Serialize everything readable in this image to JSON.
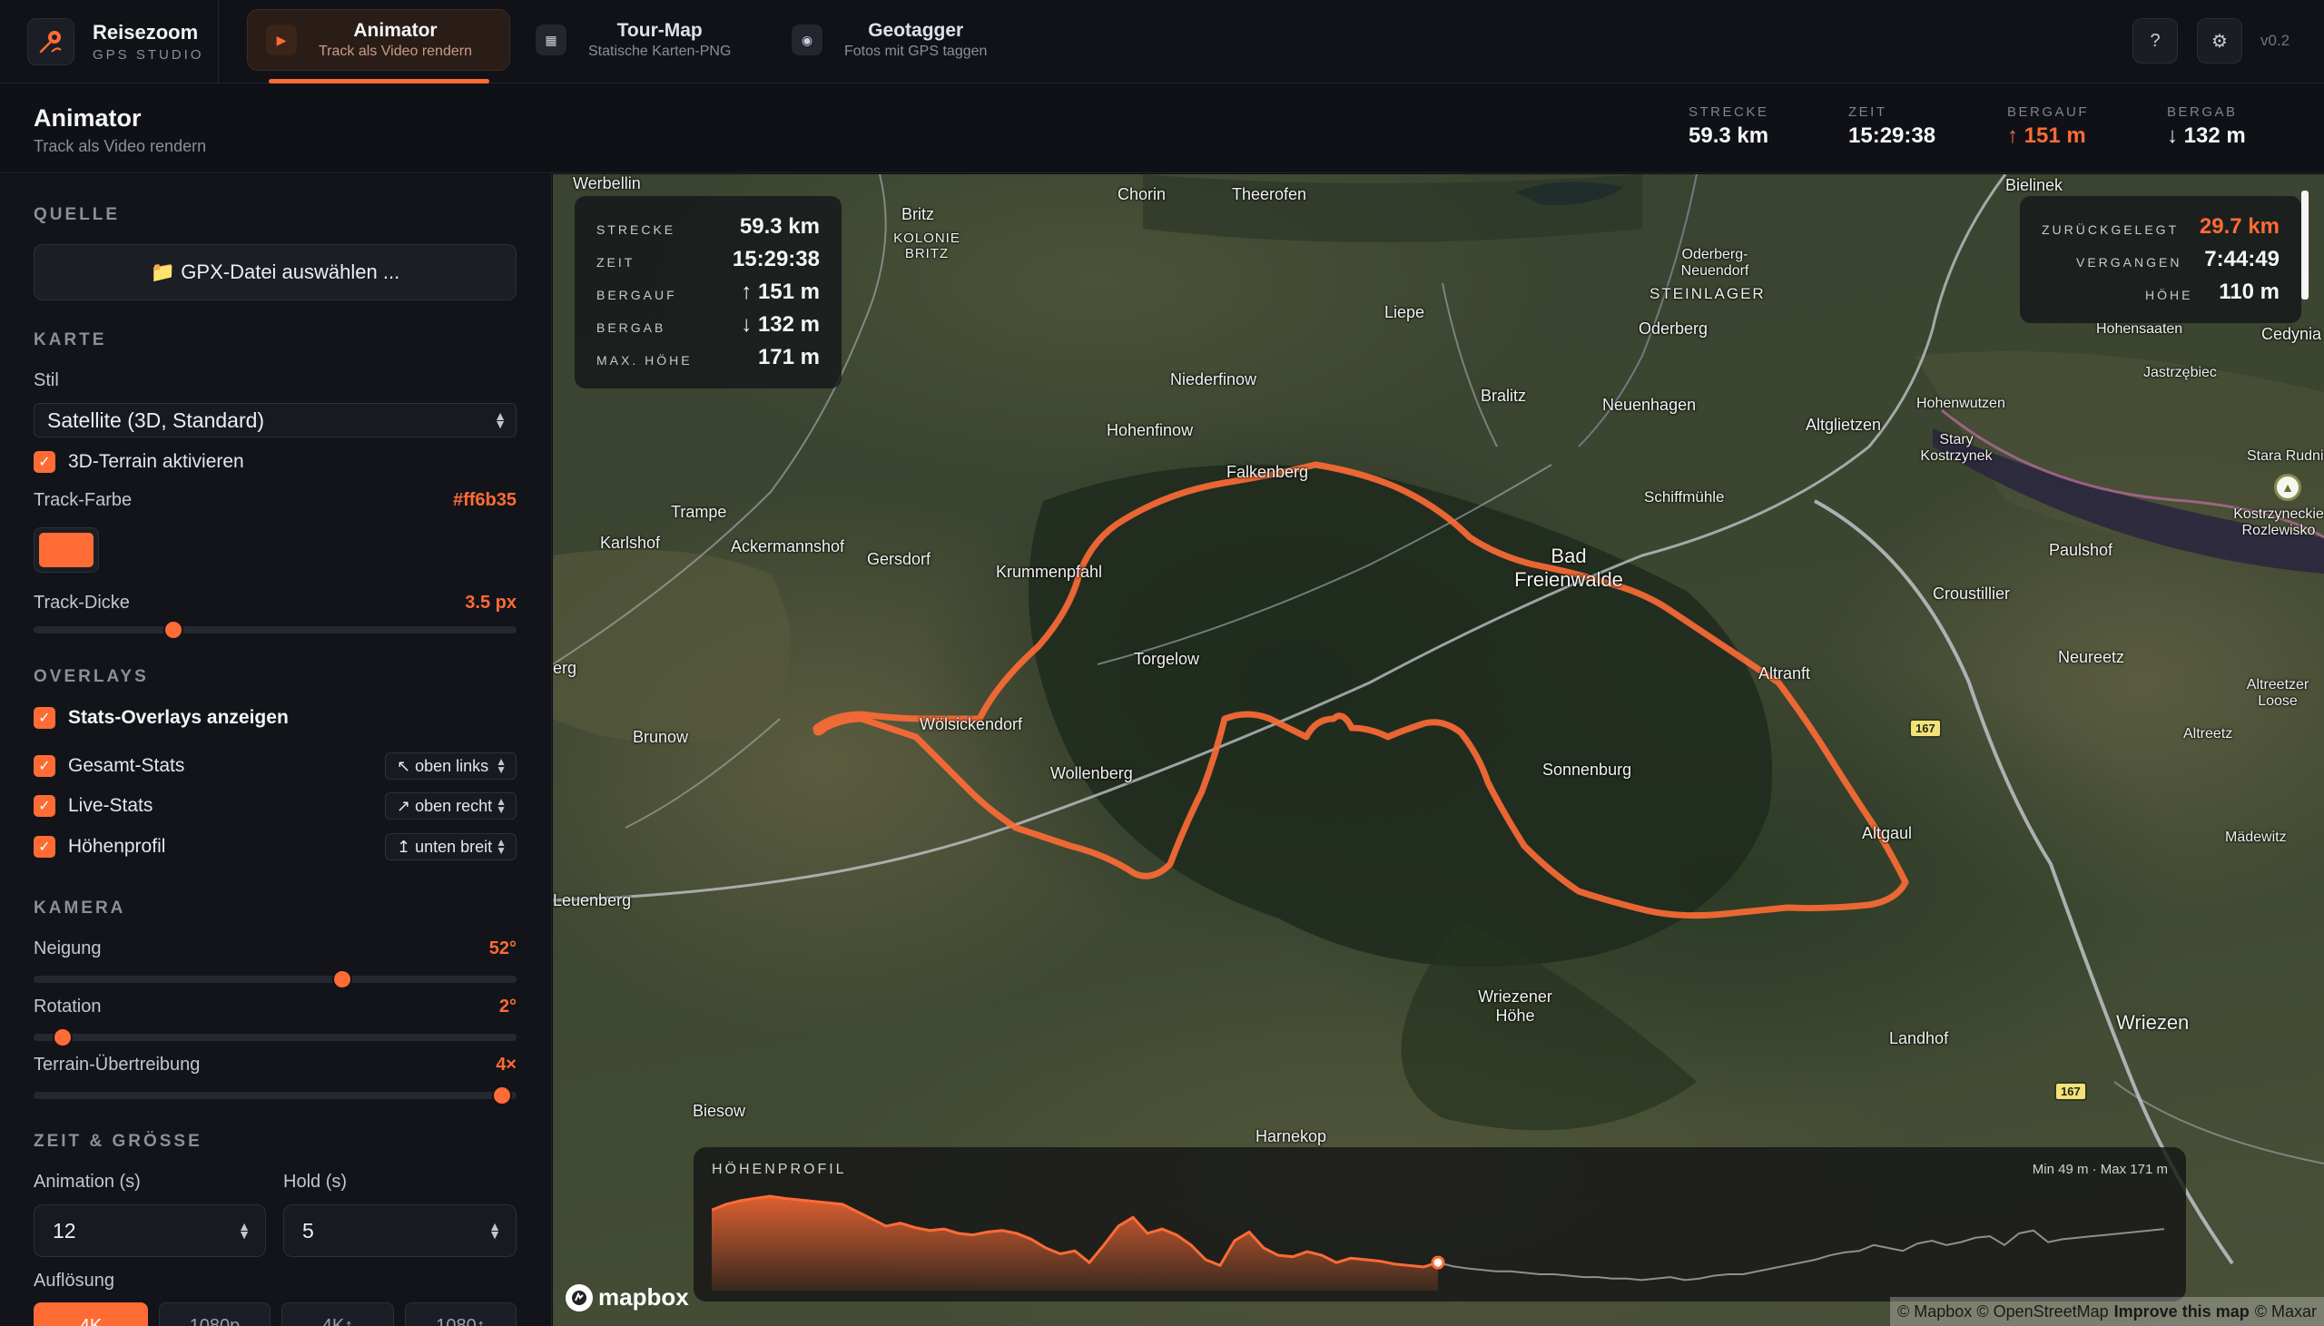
{
  "brand": {
    "name": "Reisezoom",
    "subtitle": "GPS STUDIO"
  },
  "tabs": [
    {
      "title": "Animator",
      "subtitle": "Track als Video rendern",
      "icon": "play-icon",
      "active": true
    },
    {
      "title": "Tour-Map",
      "subtitle": "Statische Karten-PNG",
      "icon": "map-icon",
      "active": false
    },
    {
      "title": "Geotagger",
      "subtitle": "Fotos mit GPS taggen",
      "icon": "pin-icon",
      "active": false
    }
  ],
  "nav": {
    "help": "?",
    "settings": "⚙",
    "version": "v0.2"
  },
  "page": {
    "title": "Animator",
    "subtitle": "Track als Video rendern"
  },
  "header_stats": [
    {
      "label": "STRECKE",
      "value": "59.3 km"
    },
    {
      "label": "ZEIT",
      "value": "15:29:38"
    },
    {
      "label": "BERGAUF",
      "value": "↑ 151 m"
    },
    {
      "label": "BERGAB",
      "value": "↓ 132 m"
    }
  ],
  "sidebar": {
    "quelle": {
      "heading": "QUELLE",
      "button": "📁 GPX-Datei auswählen ..."
    },
    "karte": {
      "heading": "KARTE",
      "style_label": "Stil",
      "style_value": "Satellite (3D, Standard)",
      "terrain_label": "3D-Terrain aktivieren",
      "terrain_checked": true,
      "track_color_label": "Track-Farbe",
      "track_color_value": "#ff6b35",
      "track_width_label": "Track-Dicke",
      "track_width_value": "3.5 px",
      "track_width_fraction": 0.29
    },
    "overlays": {
      "heading": "OVERLAYS",
      "master_label": "Stats-Overlays anzeigen",
      "items": [
        {
          "label": "Gesamt-Stats",
          "position": "↖ oben links"
        },
        {
          "label": "Live-Stats",
          "position": "↗ oben rechts"
        },
        {
          "label": "Höhenprofil",
          "position": "↥ unten breit"
        }
      ]
    },
    "kamera": {
      "heading": "KAMERA",
      "sliders": [
        {
          "label": "Neigung",
          "value": "52°",
          "fraction": 0.64
        },
        {
          "label": "Rotation",
          "value": "2°",
          "fraction": 0.06
        },
        {
          "label": "Terrain-Übertreibung",
          "value": "4×",
          "fraction": 0.97
        }
      ]
    },
    "zeit": {
      "heading": "ZEIT & GRÖSSE",
      "animation_label": "Animation (s)",
      "animation_value": "12",
      "hold_label": "Hold (s)",
      "hold_value": "5",
      "resolution_label": "Auflösung",
      "resolutions": [
        "4K",
        "1080p",
        "4K↕",
        "1080↕"
      ]
    }
  },
  "map": {
    "total_stats": [
      {
        "label": "STRECKE",
        "value": "59.3 km"
      },
      {
        "label": "ZEIT",
        "value": "15:29:38"
      },
      {
        "label": "BERGAUF",
        "value": "↑ 151 m"
      },
      {
        "label": "BERGAB",
        "value": "↓ 132 m"
      },
      {
        "label": "MAX. HÖHE",
        "value": "171 m"
      }
    ],
    "live_stats": [
      {
        "label": "ZURÜCKGELEGT",
        "value": "29.7 km"
      },
      {
        "label": "VERGANGEN",
        "value": "7:44:49"
      },
      {
        "label": "HÖHE",
        "value": "110 m"
      }
    ],
    "places": [
      "Werbellin",
      "Chorin",
      "Theerofen",
      "Britz",
      "KOLONIE BRITZ",
      "Oderberg-Neuendorf",
      "STEINLAGER",
      "Bielinek",
      "Cedynia",
      "Hohensaaten",
      "Liepe",
      "Oderberg",
      "Jastrzębiec",
      "Niederfinow",
      "Bralitz",
      "Neuenhagen",
      "Hohenwutzen",
      "Hohenfinow",
      "Altglietzen",
      "Stary Kostrzynek",
      "Stara Rudnica",
      "Falkenberg",
      "Schiffmühle",
      "Kostrzyneckie Rozlewisko",
      "Trampe",
      "Karlshof",
      "Ackermannshof",
      "Gersdorf",
      "Krummenpfahl",
      "Bad Freienwalde",
      "Paulshof",
      "Croustillier",
      "Torgelow",
      "erg",
      "Neureetz",
      "Altranft",
      "Altreetzer Loose",
      "Brunow",
      "Wölsickendorf",
      "Altreetz",
      "Wollenberg",
      "Sonnenburg",
      "Altgaul",
      "Mädewitz",
      "Leuenberg",
      "Wriezener Höhe",
      "Landhof",
      "Wriezen",
      "Biesow",
      "Harnekop"
    ],
    "road_number": "167",
    "elevation": {
      "title": "HÖHENPROFIL",
      "range": "Min 49 m · Max 171 m",
      "progress_fraction": 0.5
    },
    "mapbox_label": "mapbox",
    "attribution": {
      "mapbox": "© Mapbox",
      "osm": "© OpenStreetMap",
      "improve": "Improve this map",
      "maxar": "© Maxar"
    }
  },
  "chart_data": {
    "type": "area",
    "title": "HÖHENPROFIL",
    "xlabel": "",
    "ylabel": "",
    "ylim": [
      49,
      171
    ],
    "x": [
      0,
      1,
      2,
      3,
      4,
      5,
      6,
      7,
      8,
      9,
      10,
      11,
      12,
      13,
      14,
      15,
      16,
      17,
      18,
      19,
      20,
      21,
      22,
      23,
      24,
      25,
      26,
      27,
      28,
      29,
      30,
      31,
      32,
      33,
      34,
      35,
      36,
      37,
      38,
      39,
      40,
      41,
      42,
      43,
      44,
      45,
      46,
      47,
      48,
      49,
      50,
      51,
      52,
      53,
      54,
      55,
      56,
      57,
      58,
      59,
      60,
      61,
      62,
      63,
      64,
      65,
      66,
      67,
      68,
      69,
      70,
      71,
      72,
      73,
      74,
      75,
      76,
      77,
      78,
      79,
      80,
      81,
      82,
      83,
      84,
      85,
      86,
      87,
      88,
      89,
      90,
      91,
      92,
      93,
      94,
      95,
      96,
      97,
      98,
      99,
      100
    ],
    "series": [
      {
        "values": [
          152,
          160,
          165,
          168,
          171,
          168,
          166,
          164,
          162,
          160,
          150,
          140,
          130,
          134,
          128,
          124,
          126,
          120,
          118,
          122,
          124,
          120,
          112,
          100,
          92,
          96,
          80,
          104,
          130,
          142,
          120,
          126,
          118,
          104,
          84,
          76,
          110,
          122,
          100,
          90,
          88,
          95,
          90,
          80,
          86,
          84,
          82,
          78,
          76,
          74,
          80,
          75,
          72,
          70,
          68,
          68,
          66,
          64,
          64,
          62,
          60,
          60,
          58,
          58,
          56,
          58,
          60,
          56,
          58,
          62,
          64,
          64,
          68,
          72,
          76,
          80,
          84,
          90,
          94,
          96,
          104,
          100,
          96,
          106,
          110,
          104,
          108,
          114,
          116,
          104,
          120,
          124,
          108,
          112,
          114,
          116,
          118,
          120,
          122,
          124,
          126
        ]
      }
    ]
  }
}
